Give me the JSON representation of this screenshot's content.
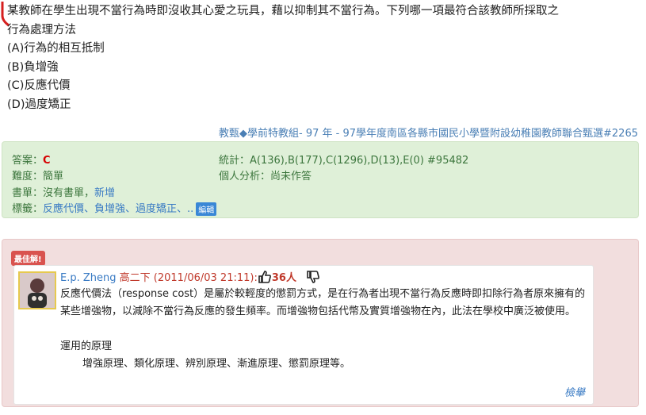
{
  "question": {
    "stem_line1": "某教師在學生出現不當行為時即沒收其心愛之玩具，藉以抑制其不當行為。下列哪一項最符合該教師所採取之",
    "stem_line2": "行為處理方法",
    "options": [
      "(A)行為的相互抵制",
      "(B)負增強",
      "(C)反應代價",
      "(D)過度矯正"
    ]
  },
  "source": {
    "category": "教甄◆學前特教組",
    "sep1": "- ",
    "year": "97 年",
    "sep2": " - ",
    "exam": "97學年度南區各縣市國民小學暨附設幼稚園教師聯合甄選#2265"
  },
  "info": {
    "answer_label": "答案：",
    "answer_value": "C",
    "difficulty_label": "難度：",
    "difficulty_value": "簡單",
    "book_label": "書單：",
    "book_value": "沒有書單，",
    "book_add": "新增",
    "tags_label": "標籤：",
    "tags_value": "反應代價、負增強、過度矯正、..",
    "edit_label": "編輯",
    "stats_label": "統計：",
    "stats_value": "A(136),B(177),C(1296),D(13),E(0) #95482",
    "personal_label": "個人分析：",
    "personal_value": "尚未作答"
  },
  "discussion": {
    "best_badge": "最佳解!",
    "author": "E.p. Zheng",
    "grade": "高二下",
    "date": "(2011/06/03 21:11):",
    "likes": "36人",
    "body_p1": "反應代價法（response cost）是屬於較輕度的懲罰方式，是在行為者出現不當行為反應時即扣除行為者原來擁有的某些增強物，以減除不當行為反應的發生頻率。而增強物包括代幣及實質增強物在內，此法在學校中廣泛被使用。",
    "body_p2": "運用的原理",
    "body_p3": "增強原理、類化原理、辨別原理、漸進原理、懲罰原理等。",
    "report_label": "檢舉"
  },
  "colors": {
    "info_bg": "#dff0d8",
    "info_text": "#3c763d",
    "answer": "#d60000",
    "discuss_bg": "#f2dede",
    "badge": "#d9534f",
    "link": "#3a7bc4"
  }
}
